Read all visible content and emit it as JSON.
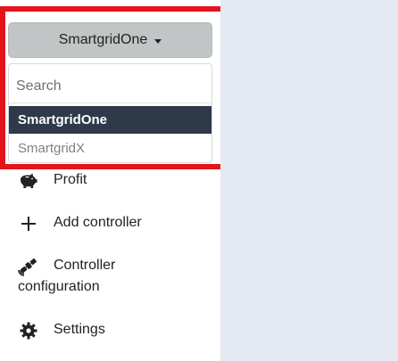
{
  "account_selector": {
    "current": "SmartgridOne",
    "search_placeholder": "Search",
    "options": [
      "SmartgridOne",
      "SmartgridX"
    ]
  },
  "nav": {
    "profit": "Profit",
    "add_controller": "Add controller",
    "controller_config_line1": "Controller",
    "controller_config_line2": "configuration",
    "settings": "Settings"
  },
  "colors": {
    "highlight": "#e3141b",
    "selected_option_bg": "#2e3a4a",
    "button_bg": "#c2c5c6",
    "page_bg": "#e4e9f2"
  },
  "icons": {
    "profit": "piggy-bank-icon",
    "add_controller": "plus-icon",
    "controller_configuration": "satellite-icon",
    "settings": "gear-icon"
  }
}
